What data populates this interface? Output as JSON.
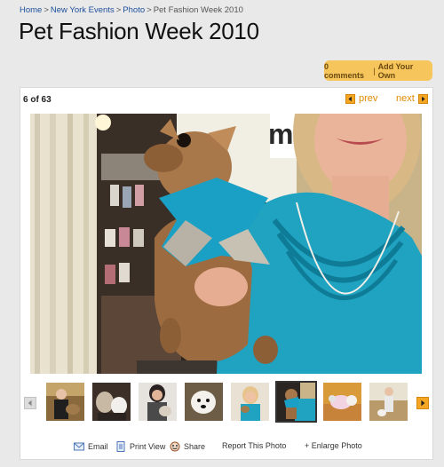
{
  "breadcrumb": {
    "items": [
      "Home",
      "New York Events",
      "Photo"
    ],
    "current": "Pet Fashion Week 2010",
    "separator": ">"
  },
  "page_title": "Pet Fashion Week 2010",
  "comments": {
    "count_label": "0 comments",
    "divider": "|",
    "add_label": "Add Your Own"
  },
  "gallery": {
    "counter": "6 of 63",
    "prev_label": "prev",
    "next_label": "next",
    "main_photo_icon": "photo-of-chihuahua-in-teal-bow-held-by-woman",
    "thumbnails": [
      {
        "icon": "dog-photo-icon",
        "active": false
      },
      {
        "icon": "dog-photo-icon",
        "active": false
      },
      {
        "icon": "dog-photo-icon",
        "active": false
      },
      {
        "icon": "dog-photo-icon",
        "active": false
      },
      {
        "icon": "dog-photo-icon",
        "active": false
      },
      {
        "icon": "dog-photo-icon",
        "active": true
      },
      {
        "icon": "dog-photo-icon",
        "active": false
      },
      {
        "icon": "dog-photo-icon",
        "active": false
      }
    ]
  },
  "actions": {
    "email": "Email",
    "print": "Print View",
    "share": "Share",
    "report": "Report This Photo",
    "enlarge": "+ Enlarge Photo"
  },
  "colors": {
    "accent_orange": "#f5a623",
    "pill_bg": "#f6c55c",
    "link_blue": "#1d4f9c",
    "dress_teal": "#1fa3c0"
  }
}
